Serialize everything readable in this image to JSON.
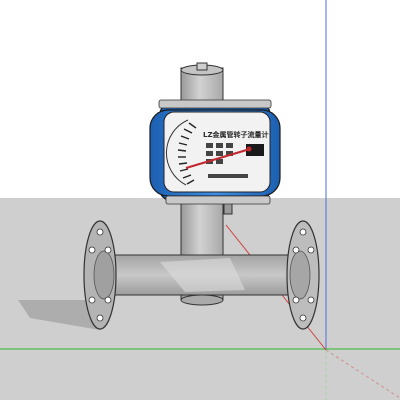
{
  "scene": {
    "kind": "3d-model-viewport",
    "background_sky": "#ffffff",
    "ground_color": "#cfcfcf",
    "axis_colors": {
      "red": "#d04040",
      "green": "#2fb52f",
      "blue": "#4f6fd8"
    }
  },
  "instrument": {
    "dial_label": "LZ金属管转子流量计",
    "housing_color": "#2f7fd6",
    "body_color": "#b9b9b9",
    "pointer_color": "#c0282d",
    "icons": [
      "flowmeter-dial-icon",
      "pointer-needle-icon",
      "flange-icon"
    ]
  }
}
